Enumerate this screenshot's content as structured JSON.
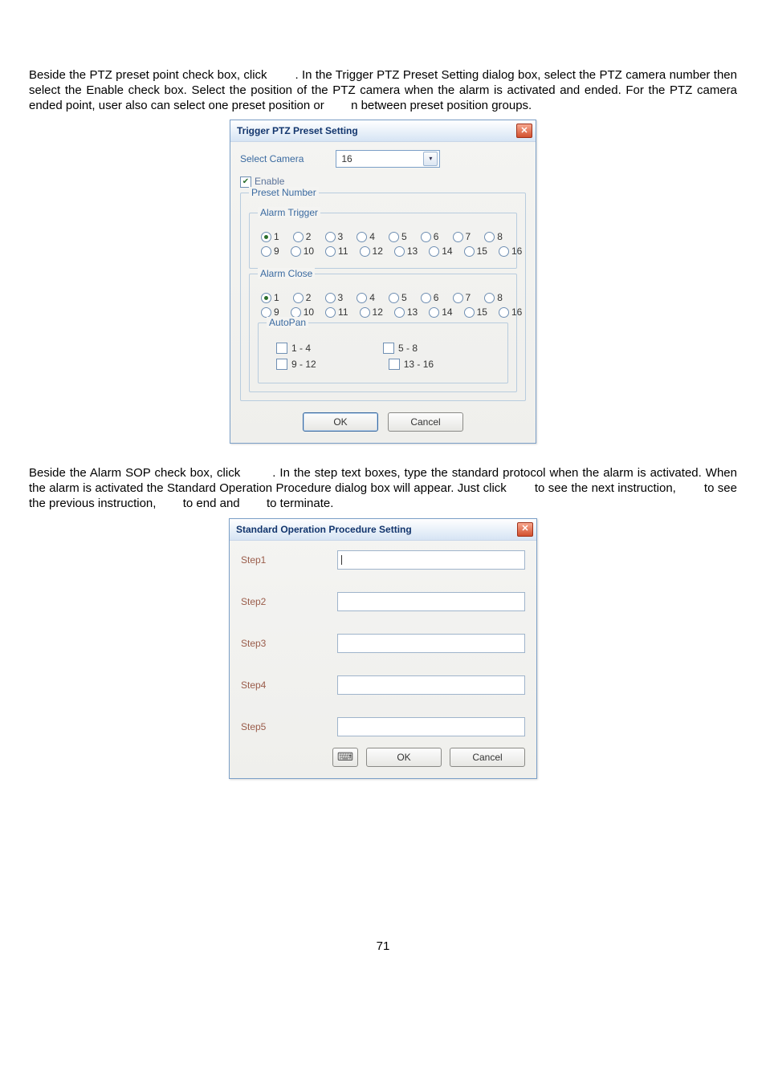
{
  "para1": "Beside the PTZ preset point check box, click        . In the Trigger PTZ Preset Setting dialog box, select the PTZ camera number then select the Enable check box. Select the position of the PTZ camera when the alarm is activated and ended. For the PTZ camera ended point, user also can select one preset position or        n between preset position groups.",
  "para2": "Beside the Alarm SOP check box, click        . In the step text boxes, type the standard protocol when the alarm is activated. When the alarm is activated the Standard Operation Procedure dialog box will appear. Just click        to see the next instruction,        to see the previous instruction,        to end and        to terminate.",
  "dialog1": {
    "title": "Trigger PTZ Preset Setting",
    "selectCameraLabel": "Select Camera",
    "selectedCamera": "16",
    "enableLabel": "Enable",
    "presetNumberLegend": "Preset Number",
    "alarmTriggerLegend": "Alarm Trigger",
    "alarmCloseLegend": "Alarm Close",
    "autoPanLegend": "AutoPan",
    "triggerRow1": [
      "1",
      "2",
      "3",
      "4",
      "5",
      "6",
      "7",
      "8"
    ],
    "triggerRow2": [
      "9",
      "10",
      "11",
      "12",
      "13",
      "14",
      "15",
      "16"
    ],
    "closeRow1": [
      "1",
      "2",
      "3",
      "4",
      "5",
      "6",
      "7",
      "8"
    ],
    "closeRow2": [
      "9",
      "10",
      "11",
      "12",
      "13",
      "14",
      "15",
      "16"
    ],
    "autopan": [
      "1 - 4",
      "5 - 8",
      "9 - 12",
      "13 - 16"
    ],
    "ok": "OK",
    "cancel": "Cancel"
  },
  "dialog2": {
    "title": "Standard Operation Procedure Setting",
    "steps": [
      "Step1",
      "Step2",
      "Step3",
      "Step4",
      "Step5"
    ],
    "ok": "OK",
    "cancel": "Cancel"
  },
  "pageNumber": "71"
}
